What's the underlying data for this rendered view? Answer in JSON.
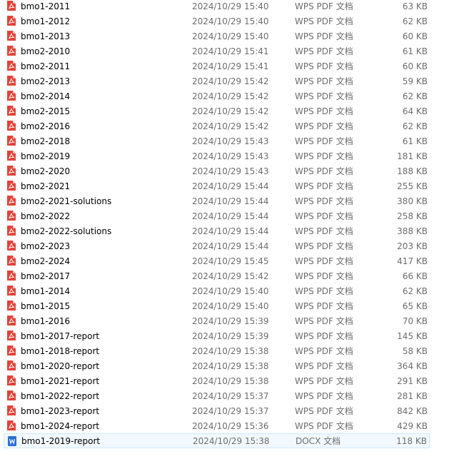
{
  "colors": {
    "pdf_icon": "#e0443a",
    "docx_icon": "#2b6fd6",
    "secondary_text": "#6d6d6d",
    "selection_bg": "#f2f8ff",
    "selection_border": "#cce8ff"
  },
  "selected_index": 29,
  "files": [
    {
      "name": "bmo1-2011",
      "date": "2024/10/29 15:40",
      "type": "WPS PDF 文档",
      "size": "63 KB",
      "icon": "pdf-icon"
    },
    {
      "name": "bmo1-2012",
      "date": "2024/10/29 15:40",
      "type": "WPS PDF 文档",
      "size": "62 KB",
      "icon": "pdf-icon"
    },
    {
      "name": "bmo1-2013",
      "date": "2024/10/29 15:40",
      "type": "WPS PDF 文档",
      "size": "60 KB",
      "icon": "pdf-icon"
    },
    {
      "name": "bmo2-2010",
      "date": "2024/10/29 15:41",
      "type": "WPS PDF 文档",
      "size": "61 KB",
      "icon": "pdf-icon"
    },
    {
      "name": "bmo2-2011",
      "date": "2024/10/29 15:41",
      "type": "WPS PDF 文档",
      "size": "60 KB",
      "icon": "pdf-icon"
    },
    {
      "name": "bmo2-2013",
      "date": "2024/10/29 15:42",
      "type": "WPS PDF 文档",
      "size": "59 KB",
      "icon": "pdf-icon"
    },
    {
      "name": "bmo2-2014",
      "date": "2024/10/29 15:42",
      "type": "WPS PDF 文档",
      "size": "62 KB",
      "icon": "pdf-icon"
    },
    {
      "name": "bmo2-2015",
      "date": "2024/10/29 15:42",
      "type": "WPS PDF 文档",
      "size": "64 KB",
      "icon": "pdf-icon"
    },
    {
      "name": "bmo2-2016",
      "date": "2024/10/29 15:42",
      "type": "WPS PDF 文档",
      "size": "62 KB",
      "icon": "pdf-icon"
    },
    {
      "name": "bmo2-2018",
      "date": "2024/10/29 15:43",
      "type": "WPS PDF 文档",
      "size": "61 KB",
      "icon": "pdf-icon"
    },
    {
      "name": "bmo2-2019",
      "date": "2024/10/29 15:43",
      "type": "WPS PDF 文档",
      "size": "181 KB",
      "icon": "pdf-icon"
    },
    {
      "name": "bmo2-2020",
      "date": "2024/10/29 15:43",
      "type": "WPS PDF 文档",
      "size": "188 KB",
      "icon": "pdf-icon"
    },
    {
      "name": "bmo2-2021",
      "date": "2024/10/29 15:44",
      "type": "WPS PDF 文档",
      "size": "255 KB",
      "icon": "pdf-icon"
    },
    {
      "name": "bmo2-2021-solutions",
      "date": "2024/10/29 15:44",
      "type": "WPS PDF 文档",
      "size": "380 KB",
      "icon": "pdf-icon"
    },
    {
      "name": "bmo2-2022",
      "date": "2024/10/29 15:44",
      "type": "WPS PDF 文档",
      "size": "258 KB",
      "icon": "pdf-icon"
    },
    {
      "name": "bmo2-2022-solutions",
      "date": "2024/10/29 15:44",
      "type": "WPS PDF 文档",
      "size": "388 KB",
      "icon": "pdf-icon"
    },
    {
      "name": "bmo2-2023",
      "date": "2024/10/29 15:44",
      "type": "WPS PDF 文档",
      "size": "203 KB",
      "icon": "pdf-icon"
    },
    {
      "name": "bmo2-2024",
      "date": "2024/10/29 15:45",
      "type": "WPS PDF 文档",
      "size": "417 KB",
      "icon": "pdf-icon"
    },
    {
      "name": "bmo2-2017",
      "date": "2024/10/29 15:42",
      "type": "WPS PDF 文档",
      "size": "66 KB",
      "icon": "pdf-icon"
    },
    {
      "name": "bmo1-2014",
      "date": "2024/10/29 15:40",
      "type": "WPS PDF 文档",
      "size": "62 KB",
      "icon": "pdf-icon"
    },
    {
      "name": "bmo1-2015",
      "date": "2024/10/29 15:40",
      "type": "WPS PDF 文档",
      "size": "65 KB",
      "icon": "pdf-icon"
    },
    {
      "name": "bmo1-2016",
      "date": "2024/10/29 15:39",
      "type": "WPS PDF 文档",
      "size": "70 KB",
      "icon": "pdf-icon"
    },
    {
      "name": "bmo1-2017-report",
      "date": "2024/10/29 15:39",
      "type": "WPS PDF 文档",
      "size": "145 KB",
      "icon": "pdf-icon"
    },
    {
      "name": "bmo1-2018-report",
      "date": "2024/10/29 15:38",
      "type": "WPS PDF 文档",
      "size": "58 KB",
      "icon": "pdf-icon"
    },
    {
      "name": "bmo1-2020-report",
      "date": "2024/10/29 15:38",
      "type": "WPS PDF 文档",
      "size": "364 KB",
      "icon": "pdf-icon"
    },
    {
      "name": "bmo1-2021-report",
      "date": "2024/10/29 15:38",
      "type": "WPS PDF 文档",
      "size": "291 KB",
      "icon": "pdf-icon"
    },
    {
      "name": "bmo1-2022-report",
      "date": "2024/10/29 15:37",
      "type": "WPS PDF 文档",
      "size": "281 KB",
      "icon": "pdf-icon"
    },
    {
      "name": "bmo1-2023-report",
      "date": "2024/10/29 15:37",
      "type": "WPS PDF 文档",
      "size": "842 KB",
      "icon": "pdf-icon"
    },
    {
      "name": "bmo1-2024-report",
      "date": "2024/10/29 15:36",
      "type": "WPS PDF 文档",
      "size": "429 KB",
      "icon": "pdf-icon"
    },
    {
      "name": "bmo1-2019-report",
      "date": "2024/10/29 15:38",
      "type": "DOCX 文档",
      "size": "118 KB",
      "icon": "docx-icon"
    }
  ]
}
